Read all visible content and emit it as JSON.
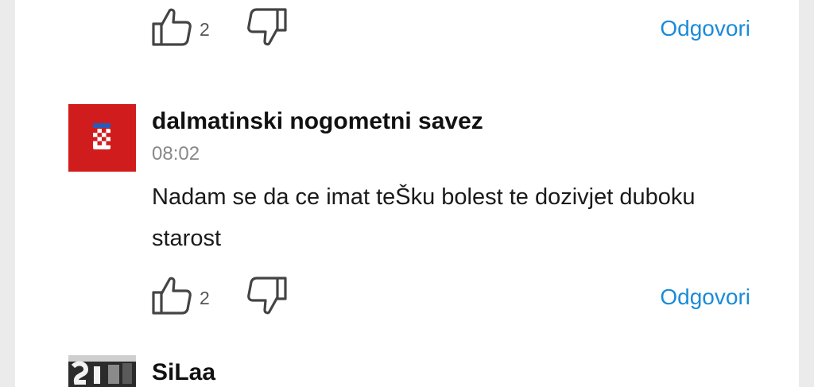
{
  "comments": [
    {
      "actions": {
        "likes": "2",
        "reply_label": "Odgovori"
      }
    },
    {
      "author": "dalmatinski nogometni savez",
      "time": "08:02",
      "text": "Nadam se da ce imat teŠku bolest te dozivjet duboku starost",
      "avatar": {
        "type": "croatian-flag-coat-of-arms",
        "color": "#d01c1c"
      },
      "actions": {
        "likes": "2",
        "reply_label": "Odgovori"
      }
    },
    {
      "author": "SiLaa",
      "avatar": {
        "type": "photo-grayscale"
      }
    }
  ],
  "colors": {
    "accent": "#1a8bd8",
    "muted": "#888888",
    "background": "#ebebeb"
  }
}
